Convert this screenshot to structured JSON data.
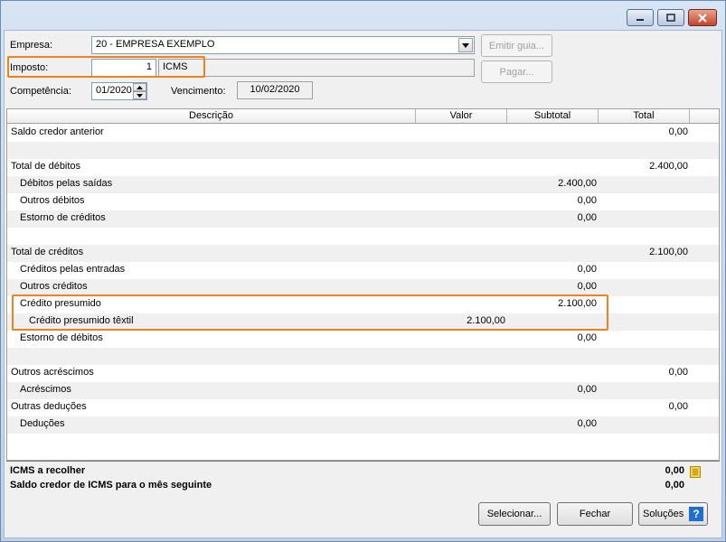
{
  "form": {
    "empresa_label": "Empresa:",
    "empresa_value": "20 - EMPRESA EXEMPLO",
    "imposto_label": "Imposto:",
    "imposto_code": "1",
    "imposto_name": "ICMS",
    "competencia_label": "Competência:",
    "competencia_value": "01/2020",
    "vencimento_label": "Vencimento:",
    "vencimento_value": "10/02/2020"
  },
  "buttons": {
    "emitir_guia": "Emitir guia...",
    "pagar": "Pagar...",
    "selecionar": "Selecionar...",
    "fechar": "Fechar",
    "solucoes": "Soluções"
  },
  "grid": {
    "columns": [
      "Descrição",
      "Valor",
      "Subtotal",
      "Total"
    ],
    "rows": [
      {
        "desc": "Saldo credor anterior",
        "indent": 0,
        "valor": "",
        "subtotal": "",
        "total": "0,00"
      },
      {
        "desc": "",
        "indent": 0,
        "valor": "",
        "subtotal": "",
        "total": ""
      },
      {
        "desc": "Total de débitos",
        "indent": 0,
        "valor": "",
        "subtotal": "",
        "total": "2.400,00"
      },
      {
        "desc": "Débitos pelas saídas",
        "indent": 1,
        "valor": "",
        "subtotal": "2.400,00",
        "total": ""
      },
      {
        "desc": "Outros débitos",
        "indent": 1,
        "valor": "",
        "subtotal": "0,00",
        "total": ""
      },
      {
        "desc": "Estorno de créditos",
        "indent": 1,
        "valor": "",
        "subtotal": "0,00",
        "total": ""
      },
      {
        "desc": "",
        "indent": 0,
        "valor": "",
        "subtotal": "",
        "total": ""
      },
      {
        "desc": "Total de créditos",
        "indent": 0,
        "valor": "",
        "subtotal": "",
        "total": "2.100,00"
      },
      {
        "desc": "Créditos pelas entradas",
        "indent": 1,
        "valor": "",
        "subtotal": "0,00",
        "total": ""
      },
      {
        "desc": "Outros créditos",
        "indent": 1,
        "valor": "",
        "subtotal": "0,00",
        "total": ""
      },
      {
        "desc": "Crédito presumido",
        "indent": 1,
        "valor": "",
        "subtotal": "2.100,00",
        "total": ""
      },
      {
        "desc": "Crédito presumido têxtil",
        "indent": 2,
        "valor": "2.100,00",
        "subtotal": "",
        "total": ""
      },
      {
        "desc": "Estorno de débitos",
        "indent": 1,
        "valor": "",
        "subtotal": "0,00",
        "total": ""
      },
      {
        "desc": "",
        "indent": 0,
        "valor": "",
        "subtotal": "",
        "total": ""
      },
      {
        "desc": "Outros acréscimos",
        "indent": 0,
        "valor": "",
        "subtotal": "",
        "total": "0,00"
      },
      {
        "desc": "Acréscimos",
        "indent": 1,
        "valor": "",
        "subtotal": "0,00",
        "total": ""
      },
      {
        "desc": "Outras deduções",
        "indent": 0,
        "valor": "",
        "subtotal": "",
        "total": "0,00"
      },
      {
        "desc": "Deduções",
        "indent": 1,
        "valor": "",
        "subtotal": "0,00",
        "total": ""
      }
    ]
  },
  "summary": {
    "icms_recolher_label": "ICMS a recolher",
    "icms_recolher_value": "0,00",
    "saldo_credor_label": "Saldo credor de ICMS para o mês seguinte",
    "saldo_credor_value": "0,00"
  },
  "colors": {
    "highlight": "#f0821e",
    "help_icon": "#1f6fd0"
  }
}
